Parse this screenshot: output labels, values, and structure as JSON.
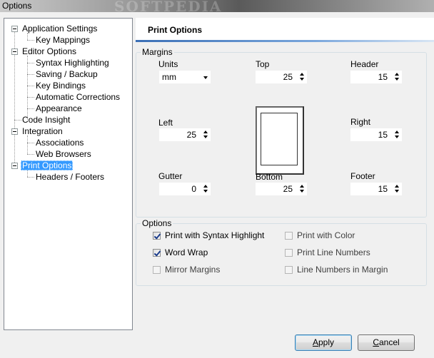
{
  "window": {
    "title": "Options"
  },
  "tree": {
    "items": [
      {
        "label": "Application Settings"
      },
      {
        "label": "Key Mappings"
      },
      {
        "label": "Editor Options"
      },
      {
        "label": "Syntax Highlighting"
      },
      {
        "label": "Saving / Backup"
      },
      {
        "label": "Key Bindings"
      },
      {
        "label": "Automatic Corrections"
      },
      {
        "label": "Appearance"
      },
      {
        "label": "Code Insight"
      },
      {
        "label": "Integration"
      },
      {
        "label": "Associations"
      },
      {
        "label": "Web Browsers"
      },
      {
        "label": "Print Options",
        "selected": true
      },
      {
        "label": "Headers / Footers"
      }
    ]
  },
  "page": {
    "title": "Print Options"
  },
  "margins": {
    "group_title": "Margins",
    "units": {
      "label": "Units",
      "value": "mm"
    },
    "top": {
      "label": "Top",
      "value": "25"
    },
    "header": {
      "label": "Header",
      "value": "15"
    },
    "left": {
      "label": "Left",
      "value": "25"
    },
    "right": {
      "label": "Right",
      "value": "15"
    },
    "gutter": {
      "label": "Gutter",
      "value": "0"
    },
    "bottom": {
      "label": "Bottom",
      "value": "25"
    },
    "footer": {
      "label": "Footer",
      "value": "15"
    }
  },
  "options": {
    "group_title": "Options",
    "syntax_highlight": {
      "label": "Print with Syntax Highlight",
      "checked": true
    },
    "print_color": {
      "label": "Print with Color",
      "checked": false
    },
    "word_wrap": {
      "label": "Word Wrap",
      "checked": true
    },
    "line_numbers": {
      "label": "Print Line Numbers",
      "checked": false
    },
    "mirror_margins": {
      "label": "Mirror Margins",
      "checked": false
    },
    "numbers_in_margin": {
      "label": "Line Numbers in Margin",
      "checked": false
    }
  },
  "buttons": {
    "apply": {
      "mnemonic": "A",
      "rest": "pply"
    },
    "cancel": {
      "mnemonic": "C",
      "rest": "ancel"
    }
  },
  "colors": {
    "selection": "#3399ff",
    "accent": "#3b6fb6"
  }
}
